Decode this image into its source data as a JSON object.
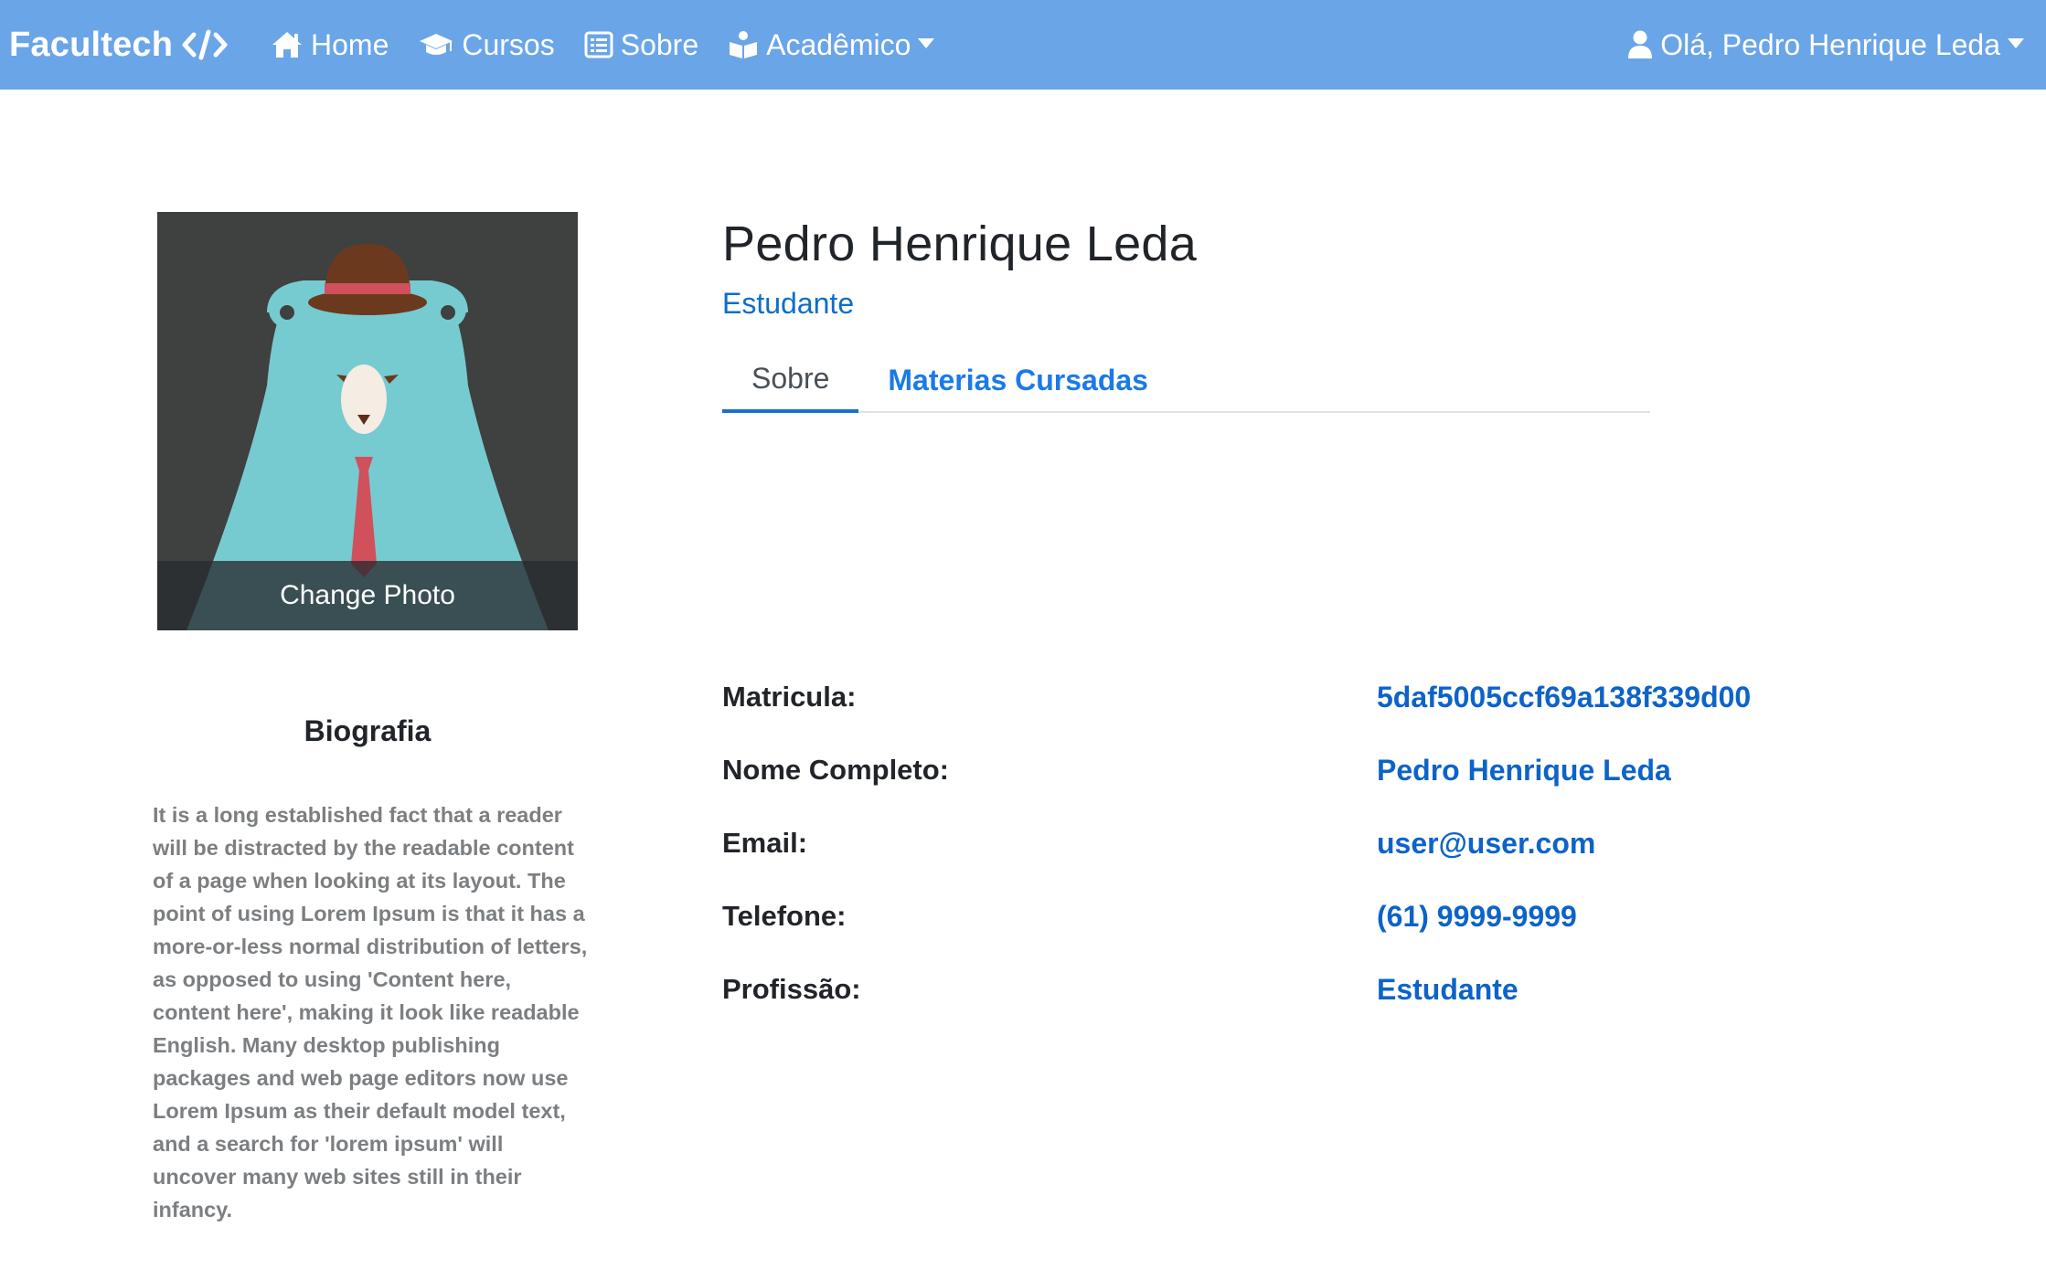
{
  "navbar": {
    "brand": "Facultech",
    "brand_icon": "code-icon",
    "links": [
      {
        "label": "Home",
        "icon": "home-icon"
      },
      {
        "label": "Cursos",
        "icon": "graduation-cap-icon"
      },
      {
        "label": "Sobre",
        "icon": "list-alt-icon"
      },
      {
        "label": "Acadêmico",
        "icon": "book-reader-icon",
        "dropdown": true
      }
    ],
    "user_greeting": "Olá, Pedro Henrique Leda",
    "user_icon": "user-icon"
  },
  "profile": {
    "change_photo_label": "Change Photo",
    "name": "Pedro Henrique Leda",
    "role": "Estudante"
  },
  "biography": {
    "title": "Biografia",
    "text": "It is a long established fact that a reader will be distracted by the readable content of a page when looking at its layout. The point of using Lorem Ipsum is that it has a more-or-less normal distribution of letters, as opposed to using 'Content here, content here', making it look like readable English. Many desktop publishing packages and web page editors now use Lorem Ipsum as their default model text, and a search for 'lorem ipsum' will uncover many web sites still in their infancy."
  },
  "tabs": [
    {
      "label": "Sobre",
      "active": true
    },
    {
      "label": "Materias Cursadas",
      "active": false
    }
  ],
  "details": [
    {
      "label": "Matricula:",
      "value": "5daf5005ccf69a138f339d00"
    },
    {
      "label": "Nome Completo:",
      "value": "Pedro Henrique Leda"
    },
    {
      "label": "Email:",
      "value": "user@user.com"
    },
    {
      "label": "Telefone:",
      "value": "(61) 9999-9999"
    },
    {
      "label": "Profissão:",
      "value": "Estudante"
    }
  ],
  "colors": {
    "navbar_bg": "#6aa5e8",
    "link_blue": "#1a7ae8",
    "value_blue": "#0d63c8",
    "avatar_bg": "#3f4040",
    "bear_body": "#76cbd0",
    "tie": "#d0505c",
    "hat": "#6b3a1e"
  }
}
